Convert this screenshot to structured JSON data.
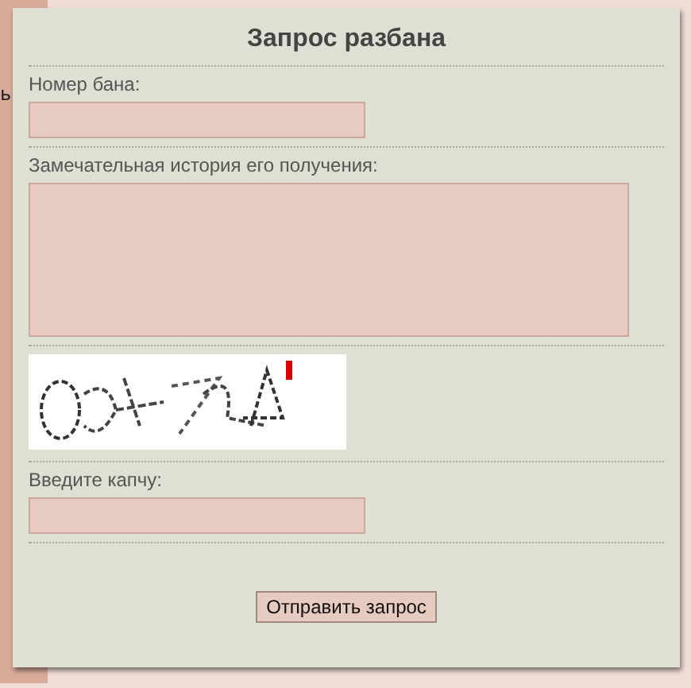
{
  "background_page": {
    "text_fragment": "ь"
  },
  "dialog": {
    "title": "Запрос разбана",
    "fields": [
      {
        "kind": "input",
        "label": "Номер бана:"
      },
      {
        "kind": "textarea",
        "label": "Замечательная история его получения:"
      },
      {
        "kind": "captcha"
      },
      {
        "kind": "input",
        "label": "Введите капчу:"
      }
    ],
    "submit": "Отправить запрос"
  }
}
